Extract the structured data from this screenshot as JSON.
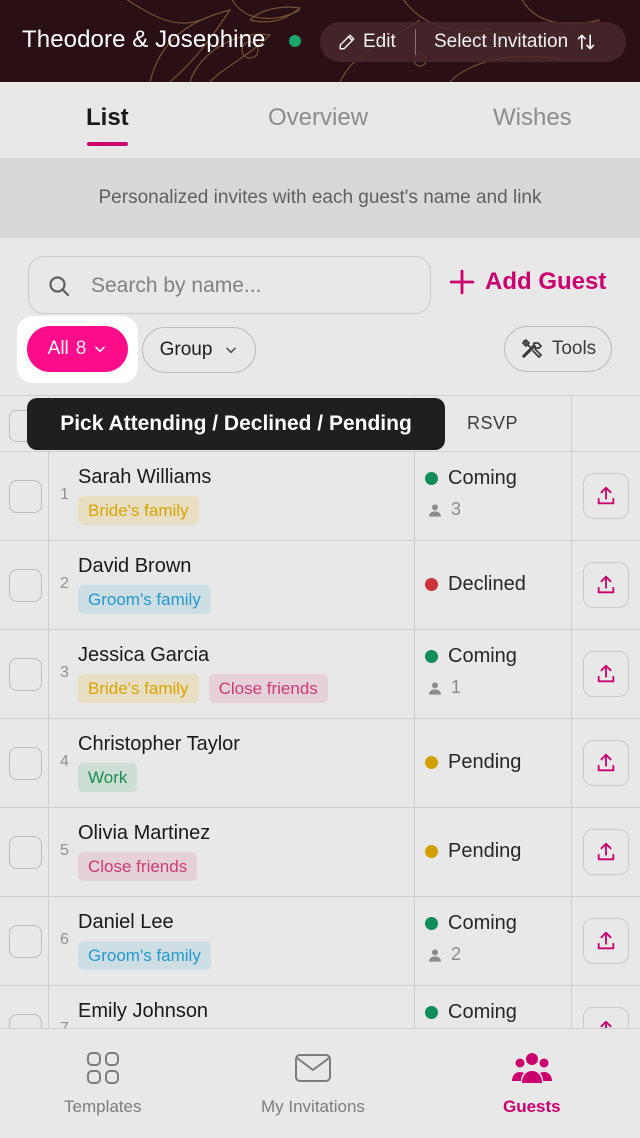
{
  "header": {
    "title": "Theodore & Josephine",
    "status": "online",
    "edit_label": "Edit",
    "select_invitation_label": "Select Invitation"
  },
  "tabs": [
    {
      "label": "List",
      "active": true
    },
    {
      "label": "Overview",
      "active": false
    },
    {
      "label": "Wishes",
      "active": false
    }
  ],
  "banner": "Personalized invites with each guest's name and link",
  "search": {
    "placeholder": "Search by name..."
  },
  "add_guest_label": "Add Guest",
  "filters": {
    "all_label": "All",
    "all_count": "8",
    "group_label": "Group",
    "tools_label": "Tools"
  },
  "tooltip": "Pick Attending / Declined / Pending",
  "table": {
    "rsvp_header": "RSVP",
    "rows": [
      {
        "num": "1",
        "name": "Sarah Williams",
        "tags": [
          {
            "label": "Bride's family",
            "kind": "bride"
          }
        ],
        "status": "Coming",
        "status_color": "#139c63",
        "guests": "3"
      },
      {
        "num": "2",
        "name": "David Brown",
        "tags": [
          {
            "label": "Groom's family",
            "kind": "groom"
          }
        ],
        "status": "Declined",
        "status_color": "#e0393e",
        "guests": ""
      },
      {
        "num": "3",
        "name": "Jessica Garcia",
        "tags": [
          {
            "label": "Bride's family",
            "kind": "bride"
          },
          {
            "label": "Close friends",
            "kind": "friends"
          }
        ],
        "status": "Coming",
        "status_color": "#139c63",
        "guests": "1"
      },
      {
        "num": "4",
        "name": "Christopher Taylor",
        "tags": [
          {
            "label": "Work",
            "kind": "work"
          }
        ],
        "status": "Pending",
        "status_color": "#e6b000",
        "guests": ""
      },
      {
        "num": "5",
        "name": "Olivia Martinez",
        "tags": [
          {
            "label": "Close friends",
            "kind": "friends"
          }
        ],
        "status": "Pending",
        "status_color": "#e6b000",
        "guests": ""
      },
      {
        "num": "6",
        "name": "Daniel Lee",
        "tags": [
          {
            "label": "Groom's family",
            "kind": "groom"
          }
        ],
        "status": "Coming",
        "status_color": "#139c63",
        "guests": "2"
      },
      {
        "num": "7",
        "name": "Emily Johnson",
        "tags": [],
        "status": "Coming",
        "status_color": "#139c63",
        "guests": ""
      }
    ]
  },
  "bottom_nav": [
    {
      "label": "Templates",
      "icon": "grid-icon",
      "active": false
    },
    {
      "label": "My Invitations",
      "icon": "envelope-icon",
      "active": false
    },
    {
      "label": "Guests",
      "icon": "people-icon",
      "active": true
    }
  ],
  "colors": {
    "accent": "#e0007a",
    "filter_pill": "#ff0c8a",
    "header_bg": "#2a0f14",
    "online": "#1aa56b"
  }
}
